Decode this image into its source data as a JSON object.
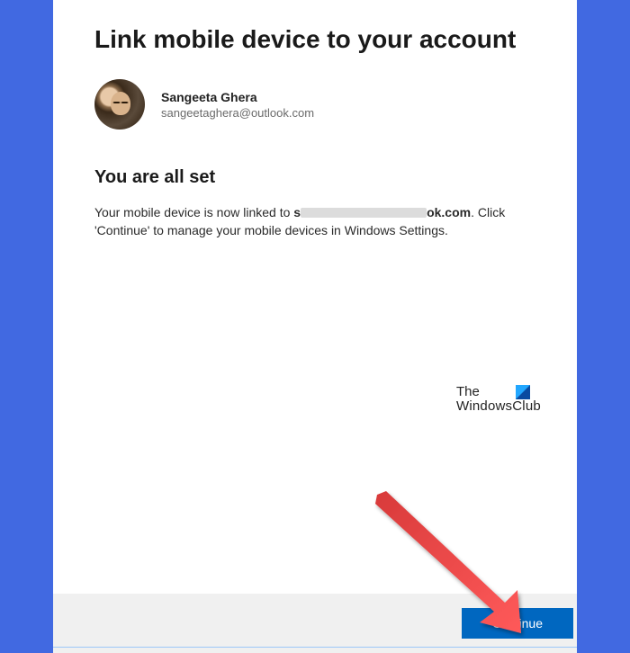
{
  "page": {
    "title": "Link mobile device to your account"
  },
  "user": {
    "name": "Sangeeta Ghera",
    "email": "sangeetaghera@outlook.com"
  },
  "status": {
    "heading": "You are all set",
    "body_prefix": "Your mobile device is now linked to ",
    "linked_email_start": "s",
    "linked_email_end": "ok.com",
    "body_suffix": ". Click 'Continue' to manage your mobile devices in Windows Settings."
  },
  "watermark": {
    "line1": "The",
    "line2": "WindowsClub"
  },
  "footer": {
    "continue_label": "Continue"
  }
}
